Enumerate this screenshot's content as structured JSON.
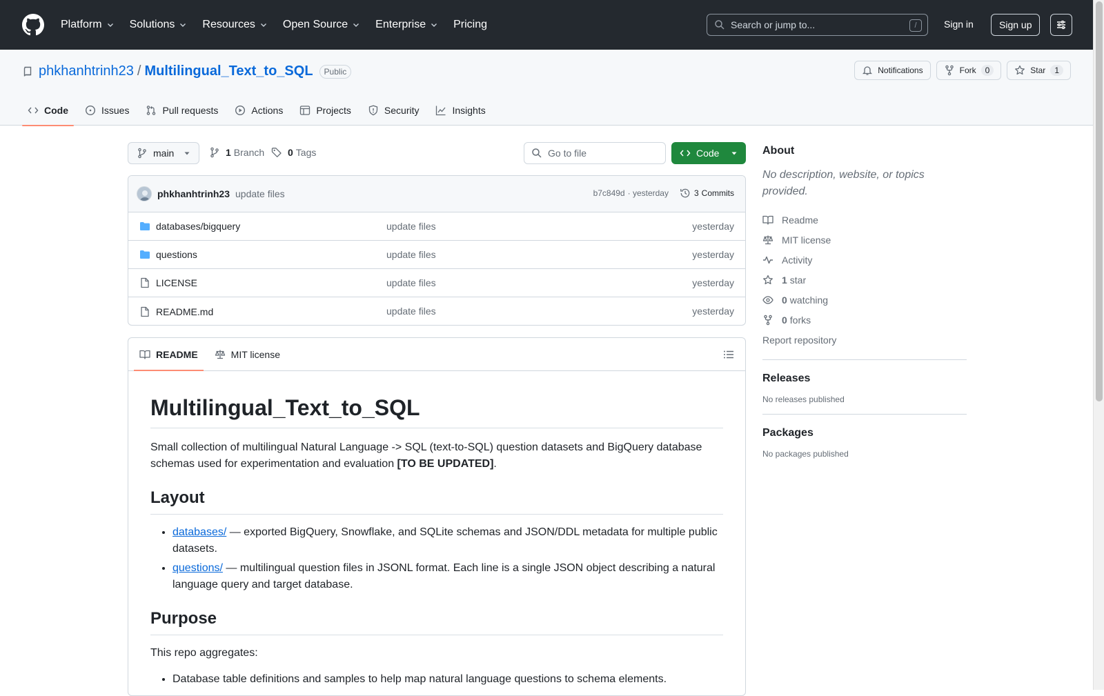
{
  "nav": {
    "items": [
      {
        "label": "Platform",
        "has_menu": true
      },
      {
        "label": "Solutions",
        "has_menu": true
      },
      {
        "label": "Resources",
        "has_menu": true
      },
      {
        "label": "Open Source",
        "has_menu": true
      },
      {
        "label": "Enterprise",
        "has_menu": true
      },
      {
        "label": "Pricing",
        "has_menu": false
      }
    ],
    "search_placeholder": "Search or jump to...",
    "search_shortcut": "/",
    "sign_in": "Sign in",
    "sign_up": "Sign up"
  },
  "repo": {
    "owner": "phkhanhtrinh23",
    "separator": "/",
    "name": "Multilingual_Text_to_SQL",
    "visibility": "Public",
    "actions": {
      "notifications": "Notifications",
      "fork": "Fork",
      "fork_count": "0",
      "star": "Star",
      "star_count": "1"
    },
    "tabs": [
      {
        "label": "Code",
        "icon": "code-icon",
        "active": true
      },
      {
        "label": "Issues",
        "icon": "issue-icon",
        "active": false
      },
      {
        "label": "Pull requests",
        "icon": "pull-request-icon",
        "active": false
      },
      {
        "label": "Actions",
        "icon": "play-icon",
        "active": false
      },
      {
        "label": "Projects",
        "icon": "table-icon",
        "active": false
      },
      {
        "label": "Security",
        "icon": "shield-icon",
        "active": false
      },
      {
        "label": "Insights",
        "icon": "graph-icon",
        "active": false
      }
    ]
  },
  "toolbar": {
    "branch": "main",
    "branch_count": "1",
    "branch_label": "Branch",
    "tag_count": "0",
    "tag_label": "Tags",
    "goto_placeholder": "Go to file",
    "code_label": "Code"
  },
  "commit": {
    "author": "phkhanhtrinh23",
    "message": "update files",
    "sha": "b7c849d",
    "time": "· yesterday",
    "commits_count": "3",
    "commits_label": "Commits"
  },
  "files": [
    {
      "type": "folder",
      "name": "databases/bigquery",
      "message": "update files",
      "date": "yesterday"
    },
    {
      "type": "folder",
      "name": "questions",
      "message": "update files",
      "date": "yesterday"
    },
    {
      "type": "file",
      "name": "LICENSE",
      "message": "update files",
      "date": "yesterday"
    },
    {
      "type": "file",
      "name": "README.md",
      "message": "update files",
      "date": "yesterday"
    }
  ],
  "readme": {
    "tabs": {
      "readme": "README",
      "license": "MIT license"
    },
    "title": "Multilingual_Text_to_SQL",
    "intro": "Small collection of multilingual Natural Language -> SQL (text-to-SQL) question datasets and BigQuery database schemas used for experimentation and evaluation ",
    "intro_bold": "[TO BE UPDATED]",
    "intro_end": ".",
    "layout_heading": "Layout",
    "layout_items": [
      {
        "link": "databases/",
        "text": " — exported BigQuery, Snowflake, and SQLite schemas and JSON/DDL metadata for multiple public datasets."
      },
      {
        "link": "questions/",
        "text": " — multilingual question files in JSONL format. Each line is a single JSON object describing a natural language query and target database."
      }
    ],
    "purpose_heading": "Purpose",
    "purpose_intro": "This repo aggregates:",
    "purpose_items": [
      "Database table definitions and samples to help map natural language questions to schema elements."
    ]
  },
  "sidebar": {
    "about_heading": "About",
    "about_desc": "No description, website, or topics provided.",
    "links": [
      {
        "icon": "book-icon",
        "count": "",
        "label": "Readme"
      },
      {
        "icon": "law-icon",
        "count": "",
        "label": "MIT license"
      },
      {
        "icon": "pulse-icon",
        "count": "",
        "label": "Activity"
      },
      {
        "icon": "star-icon",
        "count": "1",
        "label": "star"
      },
      {
        "icon": "eye-icon",
        "count": "0",
        "label": "watching"
      },
      {
        "icon": "fork-icon",
        "count": "0",
        "label": "forks"
      }
    ],
    "report": "Report repository",
    "releases_heading": "Releases",
    "releases_text": "No releases published",
    "packages_heading": "Packages",
    "packages_text": "No packages published"
  },
  "colors": {
    "header_bg": "#24292f",
    "link": "#0969da",
    "primary_button": "#1f883d",
    "active_tab_underline": "#fd8c73",
    "folder": "#54aeff"
  }
}
